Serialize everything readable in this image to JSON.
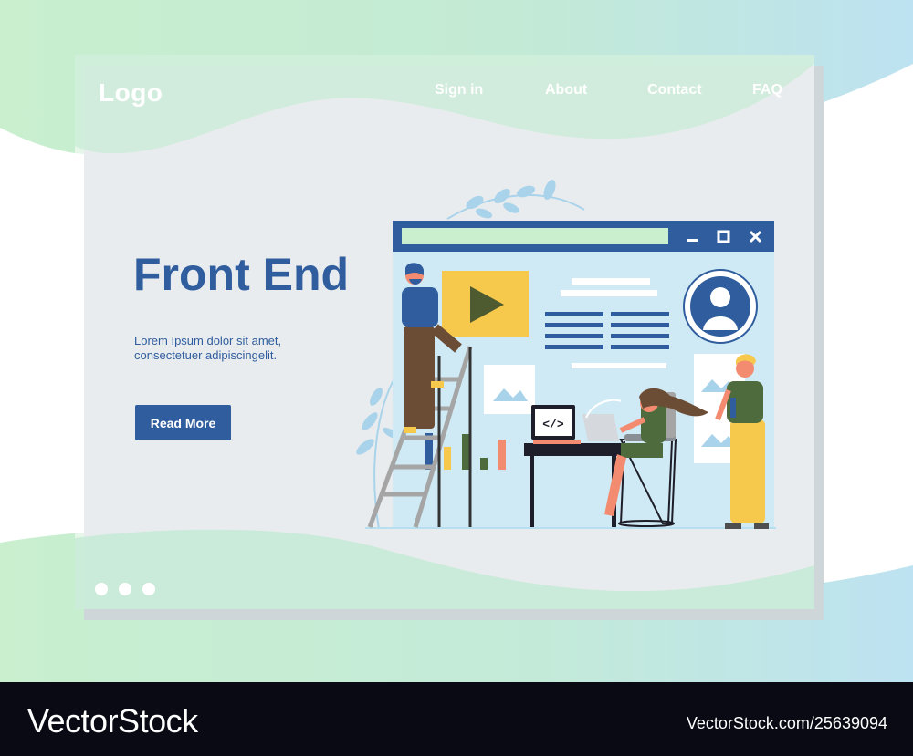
{
  "header": {
    "logo": "Logo",
    "nav": [
      {
        "label": "Sign in"
      },
      {
        "label": "About"
      },
      {
        "label": "Contact"
      },
      {
        "label": "FAQ"
      }
    ]
  },
  "hero": {
    "title": "Front End",
    "text": "Lorem Ipsum dolor sit amet, consectetuer adipiscingelit.",
    "button": "Read More"
  },
  "illustration": {
    "code_label": "</>",
    "window_controls": [
      "minimize-icon",
      "maximize-icon",
      "close-icon"
    ]
  },
  "pagination": {
    "count": 3
  },
  "footer": {
    "brand": "VectorStock",
    "image_ref": "VectorStock.com/25639094"
  },
  "colors": {
    "primary": "#2f5d9e",
    "accent_yellow": "#f6c94d",
    "window_bg": "#cfeaf4",
    "green_wave": "#bfe8c8",
    "blue_wave": "#bfe0f0"
  }
}
